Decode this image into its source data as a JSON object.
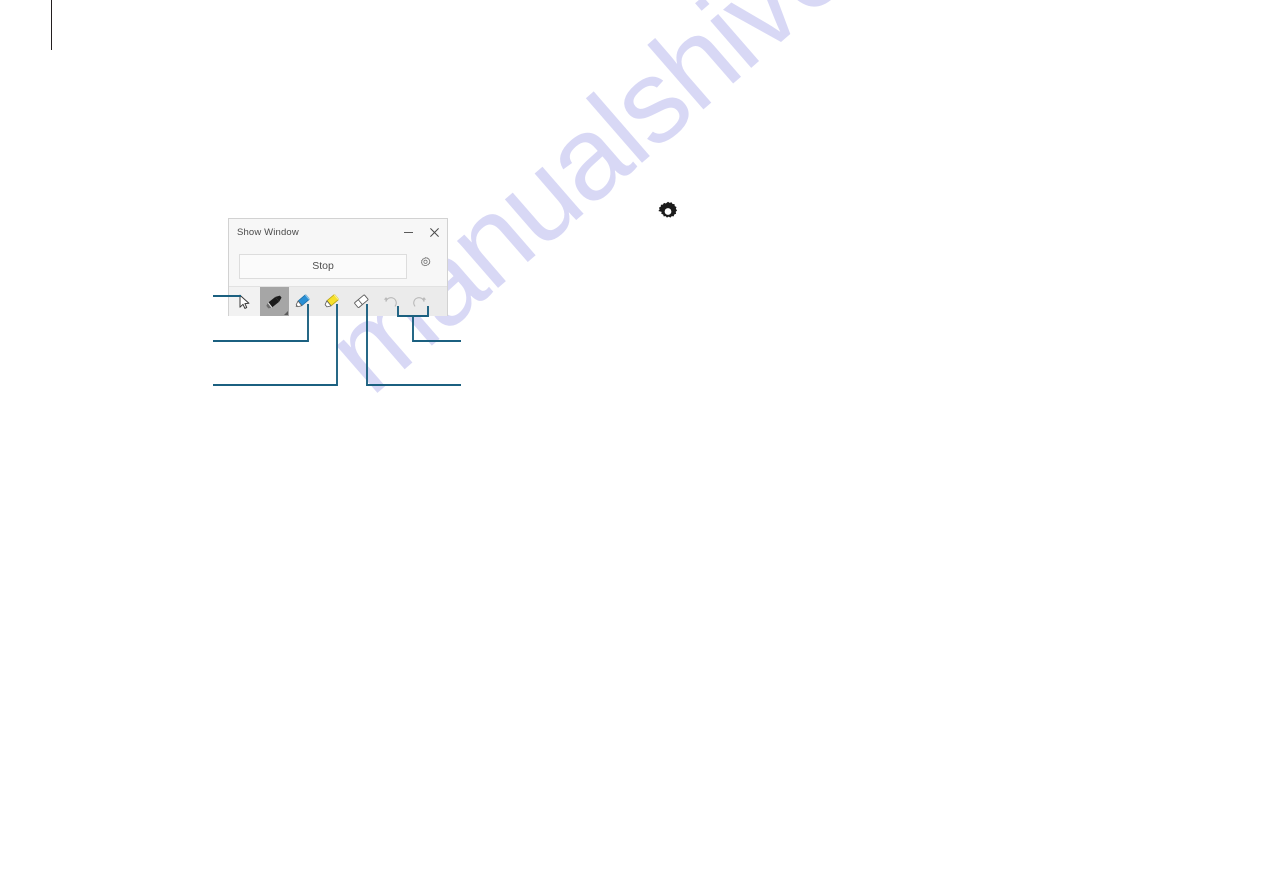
{
  "page": {
    "background_color": "#ffffff",
    "margin_rule_color": "#231f20"
  },
  "watermark": {
    "text": "manualshive.com",
    "color": "#ccccf2"
  },
  "app_window": {
    "titlebar": {
      "title": "Show Window",
      "minimize_label": "Minimize",
      "minimize_icon": "minimize-icon",
      "close_label": "Close",
      "close_icon": "close-icon"
    },
    "actions": {
      "stop_label": "Stop",
      "settings_icon": "gear-icon",
      "settings_label": "Settings"
    },
    "toolbar": {
      "tools": [
        {
          "id": "select",
          "label": "Select",
          "icon": "cursor-arrow-icon",
          "state": "normal"
        },
        {
          "id": "pen",
          "label": "Pen",
          "icon": "pen-icon",
          "state": "active"
        },
        {
          "id": "pencil",
          "label": "Pencil",
          "icon": "pencil-blue-icon",
          "state": "normal"
        },
        {
          "id": "highlighter",
          "label": "Highlighter",
          "icon": "highlighter-yellow-icon",
          "state": "normal"
        },
        {
          "id": "eraser",
          "label": "Eraser",
          "icon": "eraser-icon",
          "state": "normal"
        },
        {
          "id": "undo",
          "label": "Undo",
          "icon": "undo-arrow-icon",
          "state": "disabled"
        },
        {
          "id": "redo",
          "label": "Redo",
          "icon": "redo-arrow-icon",
          "state": "disabled"
        }
      ]
    }
  },
  "standalone_icon": {
    "name": "gear-icon",
    "label": "Settings",
    "color": "#1b1b1b"
  },
  "callouts": {
    "line_color": "#1b6080",
    "items": [
      {
        "id": "select-callout",
        "target": "select-tool"
      },
      {
        "id": "pencil-callout",
        "target": "pencil-tool"
      },
      {
        "id": "highlighter-callout",
        "target": "highlighter-tool"
      },
      {
        "id": "eraser-callout",
        "target": "eraser-tool"
      },
      {
        "id": "undo-redo-callout",
        "target": "undo-redo-tools"
      }
    ]
  }
}
